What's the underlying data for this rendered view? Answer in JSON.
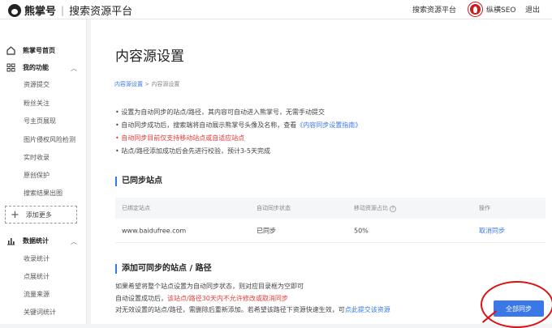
{
  "header": {
    "brand": "熊掌号",
    "separator": "|",
    "subtitle": "搜索资源平台",
    "nav_link": "搜索资源平台",
    "username": "纵横SEO",
    "logout": "退出"
  },
  "sidebar": {
    "home": "熊掌号首页",
    "my_functions": "我的功能",
    "items": [
      "资源提交",
      "粉丝关注",
      "号主页展现",
      "图片侵权风险检测",
      "实时收录",
      "原创保护",
      "搜索结果出图"
    ],
    "add_more": "添加更多",
    "data_stats": "数据统计",
    "stat_items": [
      "收录统计",
      "点展统计",
      "流量来源",
      "关键词统计"
    ]
  },
  "main": {
    "title": "内容源设置",
    "breadcrumb": {
      "parent": "内容源设置",
      "separator": ">",
      "current": "内容源设置"
    },
    "notes": {
      "line1": "设置为自动同步的站点/路径，其内容可自动进入熊掌号，无需手动提交",
      "line2_prefix": "自动同步成功后，搜索端将自动展示熊掌号头像及名称，查看",
      "line2_link": "《内容同步设置指南》",
      "line3": "自动同步目前仅支持移动站点或自适应站点",
      "line4": "站点/路径添加成功后会先进行校验，预计3-5天完成"
    },
    "synced_section": "已同步站点",
    "table": {
      "headers": [
        "已绑定站点",
        "自动同步状态",
        "移动资源占比",
        "操作"
      ],
      "help_icon": "?",
      "rows": [
        {
          "site": "www.baidufree.com",
          "status": "已同步",
          "ratio": "50%",
          "action": "取消同步"
        }
      ]
    },
    "add_section": "添加可同步的站点 / 路径",
    "bottom_notes": {
      "line1": "如果希望将整个站点设置为自动同步状态，则对应目录框为空即可",
      "line2_prefix": "自动设置成功后，",
      "line2_red": "该站点/路径30天内不允许修改或取消同步",
      "line3_prefix": "对无效设置的站点/路径，需删除后重新添加。若希望该路径下资源快速生效，可",
      "line3_link": "点此提交该资源"
    },
    "sync_button": "全部同步"
  },
  "colors": {
    "accent": "#3b78e7",
    "warning": "#e53935",
    "annotation": "#d11111"
  }
}
